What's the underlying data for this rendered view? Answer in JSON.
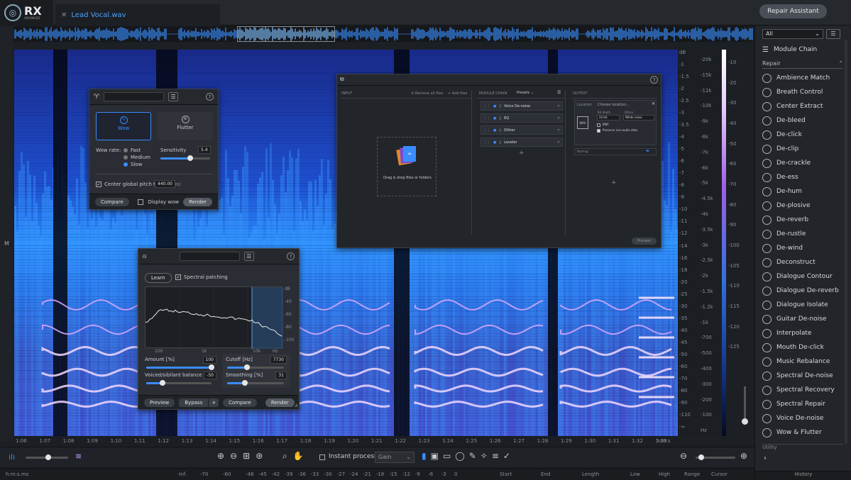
{
  "app": {
    "logo_text": "RX",
    "logo_sub": "ADVANCED",
    "tab_name": "Lead Vocal.wav",
    "repair_assistant": "Repair Assistant"
  },
  "spectrogram": {
    "channel_label": "M"
  },
  "db_scale": [
    "dB",
    "-1",
    "-1.5",
    "-2",
    "-2.5",
    "-3",
    "-3.5",
    "-4",
    "-5",
    "-6",
    "-7",
    "-8",
    "-9",
    "-10",
    "-11",
    "-12",
    "-14",
    "-16",
    "-18",
    "-20",
    "-25",
    "-30",
    "-35",
    "-40",
    "-45",
    "-50",
    "-60",
    "-70",
    "-80",
    "-90",
    "-110",
    "-∞"
  ],
  "hz_scale": [
    "-20k",
    "-15k",
    "-12k",
    "-10k",
    "-9k",
    "-8k",
    "-7k",
    "-6k",
    "-5k",
    "-4.5k",
    "-4k",
    "-3.5k",
    "-3k",
    "-2.5k",
    "-2k",
    "-1.5k",
    "-1.2k",
    "-1k",
    "-700",
    "-500",
    "-400",
    "-300",
    "-200",
    "-100",
    "Hz"
  ],
  "amp_scale": [
    "-10",
    "-20",
    "-30",
    "-40",
    "-50",
    "-60",
    "-70",
    "-80",
    "-90",
    "-100",
    "-105",
    "-110",
    "-115",
    "-120",
    "-125"
  ],
  "timeline": [
    "1:06",
    "1:07",
    "1:08",
    "1:09",
    "1:10",
    "1:11",
    "1:12",
    "1:13",
    "1:14",
    "1:15",
    "1:16",
    "1:17",
    "1:18",
    "1:19",
    "1:20",
    "1:21",
    "1:22",
    "1:23",
    "1:24",
    "1:25",
    "1:26",
    "1:27",
    "1:28",
    "1:29",
    "1:30",
    "1:31",
    "1:32",
    "1:33",
    "h:m:s"
  ],
  "toolbar": {
    "instant_process": "Instant process",
    "gain": "Gain"
  },
  "statusbar": {
    "time_format": "h:m:s.ms",
    "meter": [
      "-Inf.",
      "-70",
      "-60",
      "-48",
      "-45",
      "-42",
      "-39",
      "-36",
      "-33",
      "-30",
      "-27",
      "-24",
      "-21",
      "-18",
      "-15",
      "-12",
      "-9",
      "-6",
      "-3",
      "0"
    ],
    "cols": [
      "Start",
      "End",
      "Length",
      "Low",
      "High",
      "Range",
      "Cursor"
    ]
  },
  "right_panel": {
    "filter": "All",
    "module_chain": "Module Chain",
    "section": "Repair",
    "modules": [
      "Ambience Match",
      "Breath Control",
      "Center Extract",
      "De-bleed",
      "De-click",
      "De-clip",
      "De-crackle",
      "De-ess",
      "De-hum",
      "De-plosive",
      "De-reverb",
      "De-rustle",
      "De-wind",
      "Deconstruct",
      "Dialogue Contour",
      "Dialogue De-reverb",
      "Dialogue Isolate",
      "Guitar De-noise",
      "Interpolate",
      "Mouth De-click",
      "Music Rebalance",
      "Spectral De-noise",
      "Spectral Recovery",
      "Spectral Repair",
      "Voice De-noise",
      "Wow & Flutter"
    ],
    "utility": "Utility",
    "history": "History"
  },
  "wow_panel": {
    "wow": "Wow",
    "flutter": "Flutter",
    "wow_rate": "Wow rate:",
    "rates": [
      "Fast",
      "Medium",
      "Slow"
    ],
    "sensitivity_label": "Sensitivity",
    "sensitivity": "5.4",
    "sensitivity_level": 0.6,
    "center_label": "Center global pitch to",
    "center_value": "440.00",
    "center_unit": "Hz",
    "compare": "Compare",
    "display_wow": "Display wow",
    "render": "Render"
  },
  "batch_panel": {
    "input": "INPUT",
    "remove_all": "Remove all files",
    "add_files": "Add files",
    "drag_text": "Drag & drop files or folders",
    "module_chain": "MODULE CHAIN",
    "presets": "Presets",
    "chain": [
      "Voice De-noise",
      "EQ",
      "Dither",
      "Leveler"
    ],
    "output": "OUTPUT",
    "location": "Location",
    "choose": "Choose location...",
    "bit_depth_label": "Bit depth",
    "bit_depth": "24 bit",
    "dither_label": "Dither",
    "dither": "White noise",
    "bwf": "BWF",
    "preserve": "Preserve non-audio data",
    "format": "WAV",
    "naming": "Naming",
    "process": "Process"
  },
  "deess_panel": {
    "learn": "Learn",
    "spectral_patching": "Spectral patching",
    "graph_db": [
      "dB",
      "-40",
      "-60",
      "-80",
      "-100"
    ],
    "graph_hz": [
      "100",
      "1k",
      "10k",
      "Hz"
    ],
    "amount_label": "Amount [%]",
    "amount": "100",
    "amount_level": 1.0,
    "cutoff_label": "Cutoff [Hz]",
    "cutoff": "7730",
    "cutoff_level": 0.35,
    "balance_label": "Voiced/sibilant balance",
    "balance": "-50",
    "balance_level": 0.25,
    "smoothing_label": "Smoothing [%]",
    "smoothing": "31",
    "smoothing_level": 0.31,
    "preview": "Preview",
    "bypass": "Bypass",
    "plus": "+",
    "compare": "Compare",
    "render": "Render"
  }
}
